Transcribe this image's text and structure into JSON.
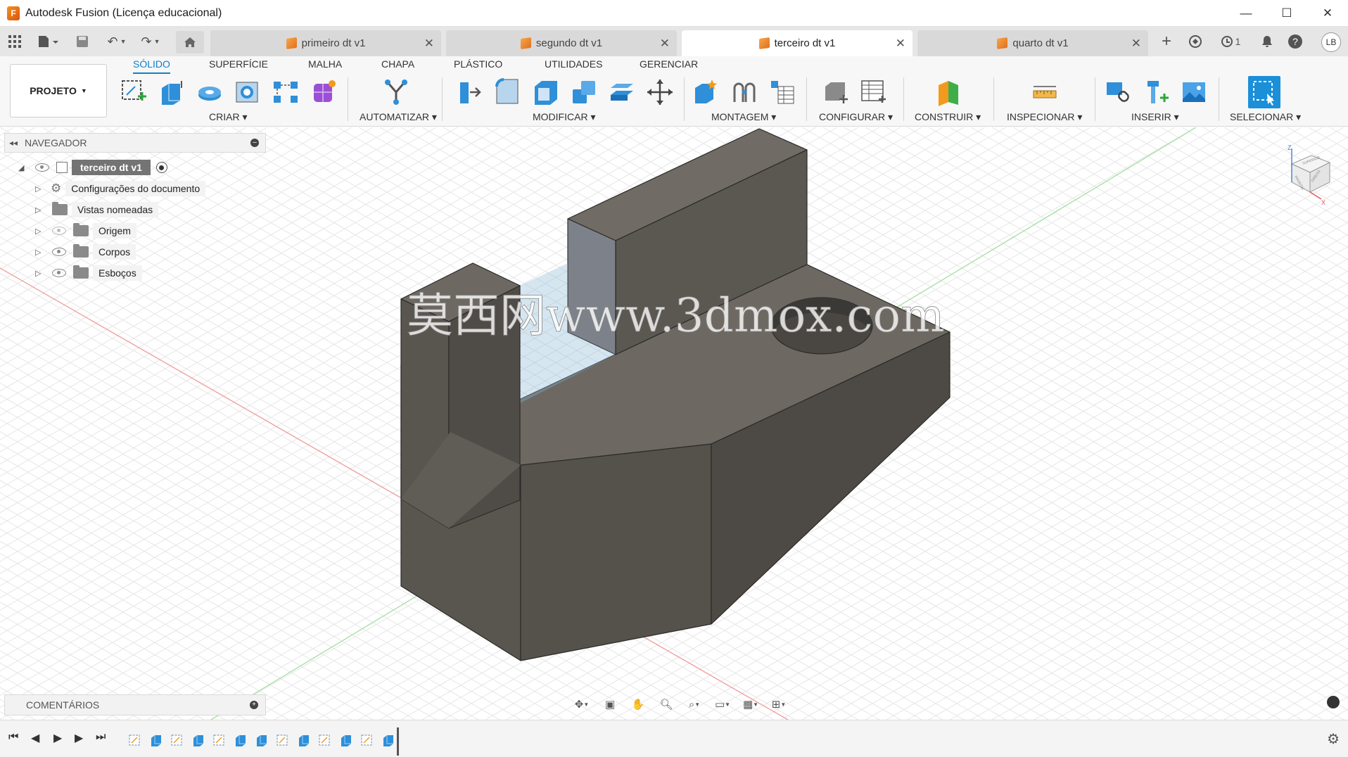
{
  "window": {
    "title": "Autodesk Fusion (Licença educacional)",
    "controls": {
      "minimize": "—",
      "maximize": "☐",
      "close": "✕"
    }
  },
  "tabs": [
    {
      "label": "primeiro dt v1",
      "active": false
    },
    {
      "label": "segundo dt v1",
      "active": false
    },
    {
      "label": "terceiro dt v1",
      "active": true
    },
    {
      "label": "quarto dt v1",
      "active": false
    }
  ],
  "tabbar_right": {
    "jobs_count": "1",
    "user_initials": "LB",
    "new_tab": "+",
    "help": "?"
  },
  "ribbon": {
    "project_button": "PROJETO",
    "tabs": [
      "SÓLIDO",
      "SUPERFÍCIE",
      "MALHA",
      "CHAPA",
      "PLÁSTICO",
      "UTILIDADES",
      "GERENCIAR"
    ],
    "active_tab": "SÓLIDO",
    "groups": [
      "CRIAR",
      "AUTOMATIZAR",
      "MODIFICAR",
      "MONTAGEM",
      "CONFIGURAR",
      "CONSTRUIR",
      "INSPECIONAR",
      "INSERIR",
      "SELECIONAR"
    ],
    "accent_color": "#1180c9"
  },
  "navigator": {
    "title": "NAVEGADOR",
    "root": "terceiro dt v1",
    "items": [
      {
        "label": "Configurações do documento",
        "icon": "gear-icon"
      },
      {
        "label": "Vistas nomeadas",
        "icon": "folder-icon"
      },
      {
        "label": "Origem",
        "icon": "folder-icon",
        "visible": false
      },
      {
        "label": "Corpos",
        "icon": "folder-icon",
        "visible": true
      },
      {
        "label": "Esboços",
        "icon": "folder-icon",
        "visible": true
      }
    ]
  },
  "viewcube": {
    "top": "SUPERIOR",
    "front": "FRONTAL",
    "right": "DIREITA",
    "axis_z": "Z",
    "axis_x": "X"
  },
  "watermark": "莫西网www.3dmox.com",
  "comments": {
    "label": "COMENTÁRIOS"
  },
  "colors": {
    "body_top": "#6e6a63",
    "body_front": "#5b5852",
    "body_side": "#4a4743",
    "grid": "#e4e4e4"
  }
}
